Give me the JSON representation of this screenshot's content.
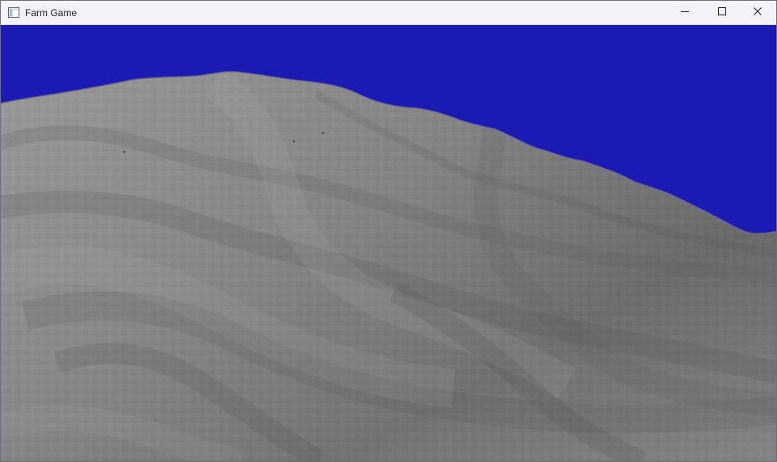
{
  "window": {
    "title": "Farm Game",
    "icon": "application-window-icon",
    "controls": {
      "minimize": "minimize-icon",
      "maximize": "maximize-icon",
      "close": "close-icon"
    }
  },
  "scene": {
    "sky_color": "#1b1bb4",
    "terrain_color": "#8f8f8f",
    "terrain_shadow_color": "#666666"
  }
}
